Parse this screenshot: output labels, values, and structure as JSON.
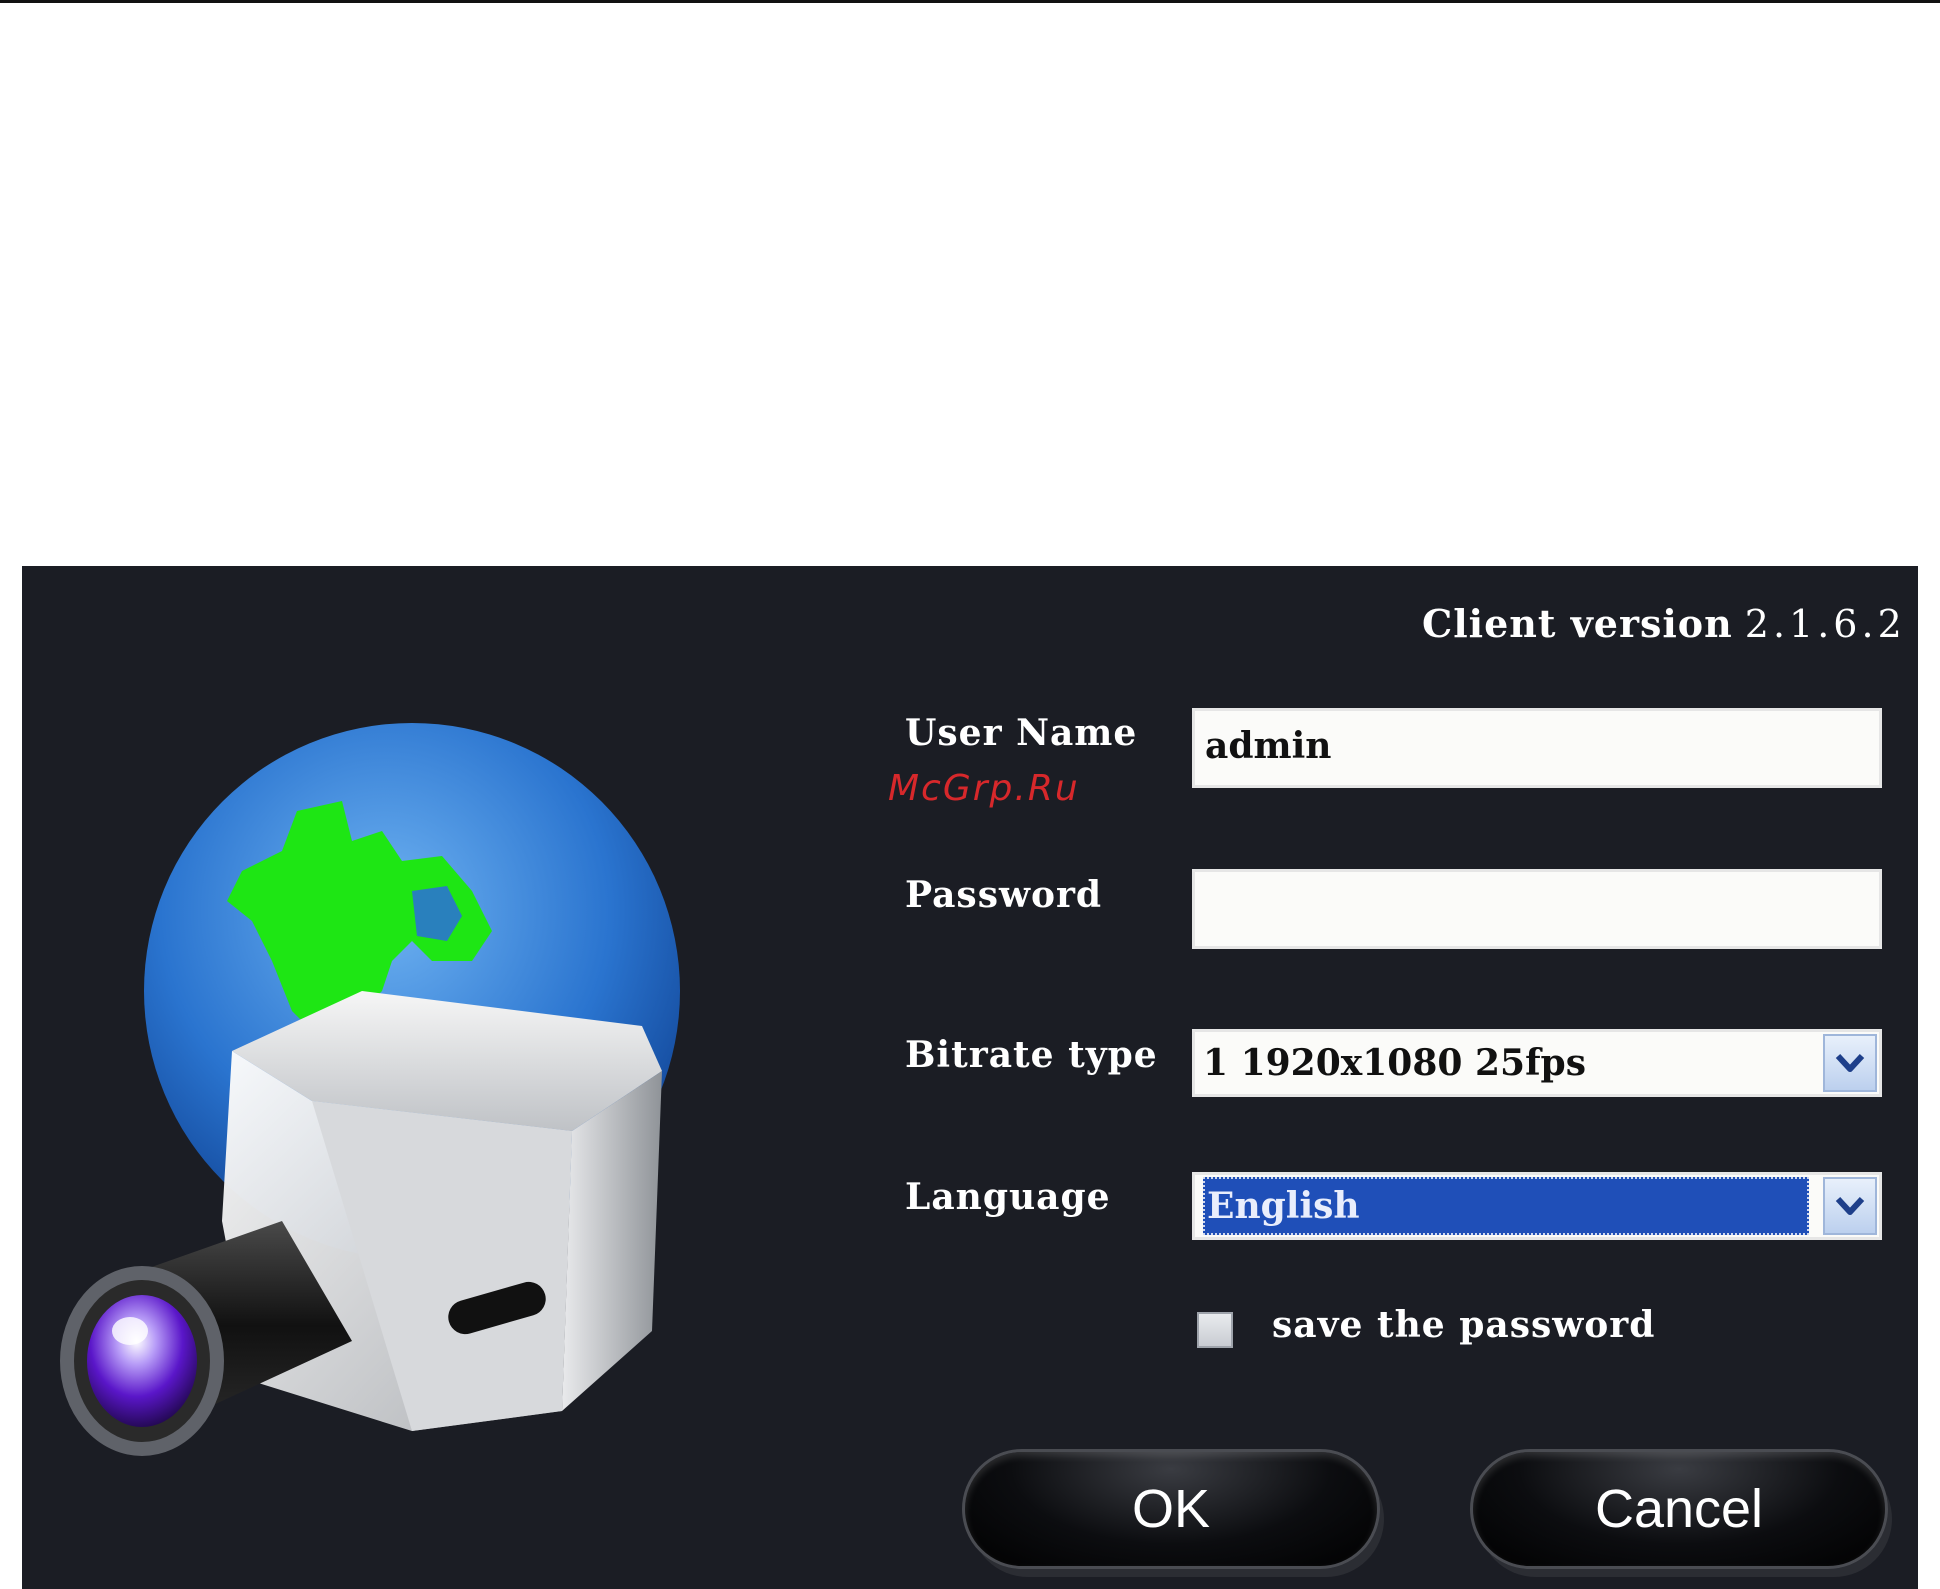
{
  "login": {
    "client_version_label": "Client version",
    "client_version_number": "2.1.6.2",
    "username_label": "User Name",
    "username_value": "admin",
    "password_label": "Password",
    "password_value": "",
    "bitrate_label": "Bitrate type",
    "bitrate_value": "1 1920x1080 25fps",
    "language_label": "Language",
    "language_value": "English",
    "save_password_label": "save the password",
    "save_password_checked": false,
    "ok_label": "OK",
    "cancel_label": "Cancel",
    "watermark": "McGrp.Ru"
  },
  "icons": {
    "logo": "globe-camera-icon",
    "dropdown": "chevron-down-icon"
  },
  "colors": {
    "panel_bg": "#1b1d24",
    "selection": "#1f4fb8",
    "globe": "#2f7fd6",
    "land": "#1ee614",
    "watermark": "#d7282b"
  }
}
